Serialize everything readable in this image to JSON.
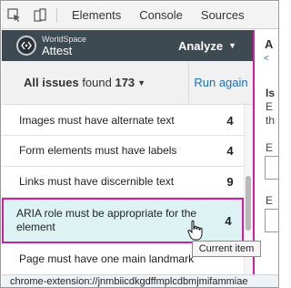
{
  "devtools": {
    "tabs": [
      "Elements",
      "Console",
      "Sources"
    ],
    "icons": [
      "inspect-element-icon",
      "device-toolbar-icon"
    ]
  },
  "header": {
    "logo_top": "WorldSpace",
    "logo_bottom": "Attest",
    "analyze_label": "Analyze",
    "analyze_caret": "▼"
  },
  "summary": {
    "prefix": "All issues",
    "middle": " found ",
    "count": "173",
    "caret": "▼",
    "run_again": "Run again"
  },
  "issues": [
    {
      "label": "Images must have alternate text",
      "count": "4"
    },
    {
      "label": "Form elements must have labels",
      "count": "4"
    },
    {
      "label": "Links must have discernible text",
      "count": "9"
    },
    {
      "label": "ARIA role must be appropriate for the element",
      "count": "4",
      "selected": true
    },
    {
      "label": "Page must have one main landmark",
      "count": ""
    }
  ],
  "right_panel": {
    "letters": [
      "A",
      "<",
      "Is",
      "E",
      "th",
      "E",
      "E"
    ]
  },
  "tooltip": "Current item",
  "status_bar": "chrome-extension://jnmbiicdkgdffmplcdbmjmifammiae",
  "colors": {
    "header_bg": "#3d4a52",
    "accent_link": "#1a6fb0",
    "selection_border": "#cc1ea6",
    "selection_bg": "#ddf3f3"
  }
}
